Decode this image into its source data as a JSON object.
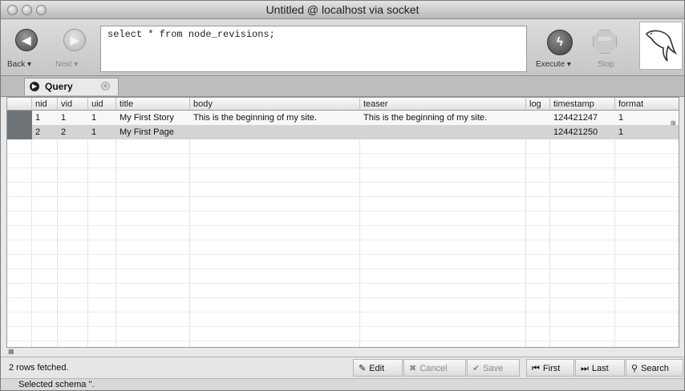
{
  "window": {
    "title": "Untitled @ localhost via socket"
  },
  "toolbar": {
    "back_label": "Back ▾",
    "next_label": "Next ▾",
    "query_text": "select * from node_revisions;",
    "execute_label": "Execute ▾",
    "stop_label": "Stop",
    "stop_badge": "STOP"
  },
  "tabs": [
    {
      "label": "Query"
    }
  ],
  "table": {
    "columns": [
      "nid",
      "vid",
      "uid",
      "title",
      "body",
      "teaser",
      "log",
      "timestamp",
      "format"
    ],
    "rows": [
      [
        "1",
        "1",
        "1",
        "My First Story",
        "This is the beginning of my site.",
        "This is the beginning of my site.",
        "",
        "124421247",
        "1"
      ],
      [
        "2",
        "2",
        "1",
        "My First Page",
        "",
        "",
        "",
        "124421250",
        "1"
      ]
    ]
  },
  "status": {
    "message": "2 rows fetched.",
    "edit": "Edit",
    "cancel": "Cancel",
    "save": "Save",
    "first": "First",
    "last": "Last",
    "search": "Search"
  },
  "footer": {
    "schema": "Selected schema ''."
  },
  "icons": {
    "back": "left-arrow-icon",
    "next": "right-arrow-icon",
    "execute": "lightning-icon",
    "stop": "stop-sign-icon",
    "logo": "dolphin-logo-icon",
    "tab": "query-icon",
    "edit": "pencil-icon",
    "cancel": "x-icon",
    "save": "check-icon",
    "first": "first-record-icon",
    "last": "last-record-icon",
    "search": "magnifier-icon"
  }
}
